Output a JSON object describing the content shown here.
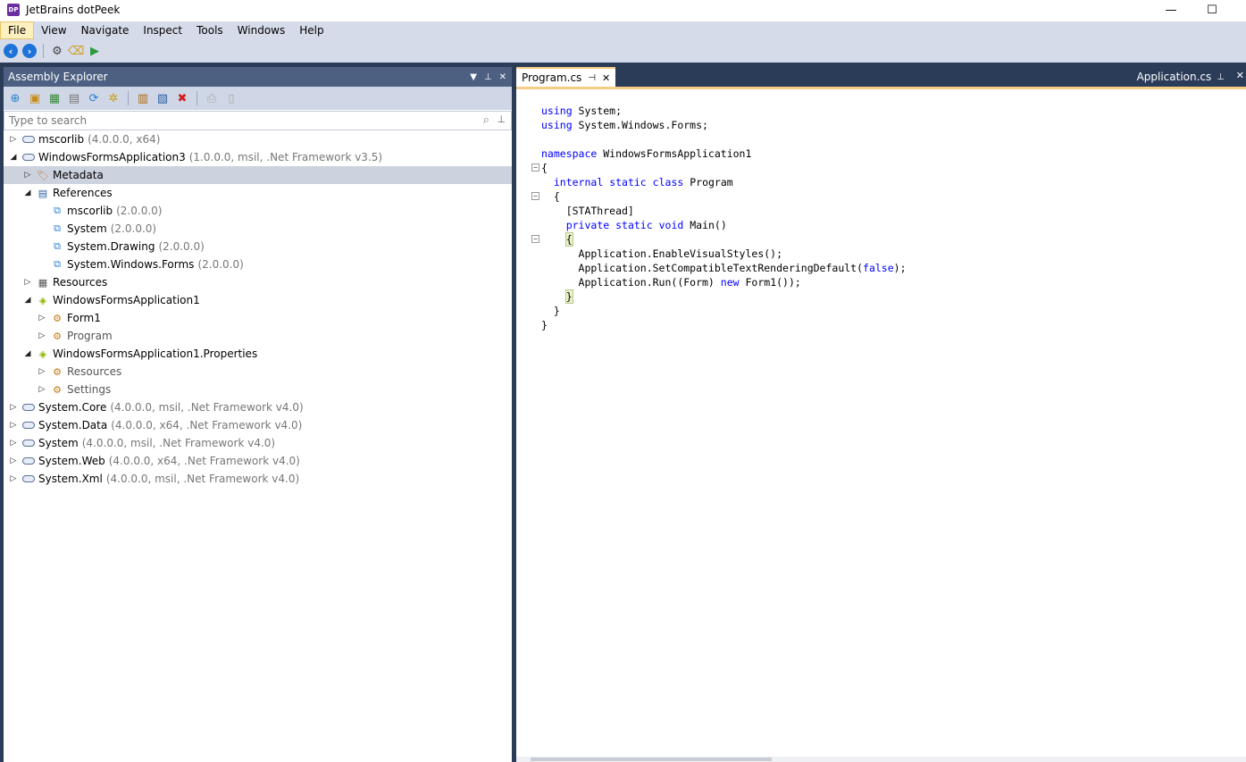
{
  "app": {
    "title": "JetBrains dotPeek",
    "icon_label": "DP"
  },
  "window_controls": {
    "minimize": "—",
    "maximize": "☐"
  },
  "menu": {
    "items": [
      "File",
      "View",
      "Navigate",
      "Inspect",
      "Tools",
      "Windows",
      "Help"
    ],
    "active": "File"
  },
  "toolbar": {
    "icons": [
      "back-icon",
      "forward-icon",
      "settings-icon",
      "find-usages-icon",
      "run-icon"
    ]
  },
  "assembly_explorer": {
    "title": "Assembly Explorer",
    "search_placeholder": "Type to search",
    "tree": [
      {
        "name": "mscorlib",
        "meta": "(4.0.0.0, x64)",
        "expander": "▷",
        "icon": "assembly-icon"
      },
      {
        "name": "WindowsFormsApplication3",
        "meta": "(1.0.0.0, msil, .Net Framework v3.5)",
        "expander": "◢",
        "icon": "assembly-icon"
      },
      {
        "name": "Metadata",
        "meta": "",
        "expander": "▷",
        "icon": "tag-icon",
        "selected": true
      },
      {
        "name": "References",
        "meta": "",
        "expander": "◢",
        "icon": "references-icon"
      },
      {
        "name": "mscorlib",
        "meta": "(2.0.0.0)",
        "expander": "",
        "icon": "reference-icon"
      },
      {
        "name": "System",
        "meta": "(2.0.0.0)",
        "expander": "",
        "icon": "reference-icon"
      },
      {
        "name": "System.Drawing",
        "meta": "(2.0.0.0)",
        "expander": "",
        "icon": "reference-icon"
      },
      {
        "name": "System.Windows.Forms",
        "meta": "(2.0.0.0)",
        "expander": "",
        "icon": "reference-icon"
      },
      {
        "name": "Resources",
        "meta": "",
        "expander": "▷",
        "icon": "resources-icon"
      },
      {
        "name": "WindowsFormsApplication1",
        "meta": "",
        "expander": "◢",
        "icon": "namespace-icon"
      },
      {
        "name": "Form1",
        "meta": "",
        "expander": "▷",
        "icon": "class-icon"
      },
      {
        "name": "Program",
        "meta": "",
        "expander": "▷",
        "icon": "class-icon",
        "dim": true
      },
      {
        "name": "WindowsFormsApplication1.Properties",
        "meta": "",
        "expander": "◢",
        "icon": "namespace-icon"
      },
      {
        "name": "Resources",
        "meta": "",
        "expander": "▷",
        "icon": "class-icon",
        "dim": true
      },
      {
        "name": "Settings",
        "meta": "",
        "expander": "▷",
        "icon": "class-icon",
        "dim": true
      },
      {
        "name": "System.Core",
        "meta": "(4.0.0.0, msil, .Net Framework v4.0)",
        "expander": "▷",
        "icon": "assembly-icon"
      },
      {
        "name": "System.Data",
        "meta": "(4.0.0.0, x64, .Net Framework v4.0)",
        "expander": "▷",
        "icon": "assembly-icon"
      },
      {
        "name": "System",
        "meta": "(4.0.0.0, msil, .Net Framework v4.0)",
        "expander": "▷",
        "icon": "assembly-icon"
      },
      {
        "name": "System.Web",
        "meta": "(4.0.0.0, x64, .Net Framework v4.0)",
        "expander": "▷",
        "icon": "assembly-icon"
      },
      {
        "name": "System.Xml",
        "meta": "(4.0.0.0, msil, .Net Framework v4.0)",
        "expander": "▷",
        "icon": "assembly-icon"
      }
    ]
  },
  "editor": {
    "active_tab": "Program.cs",
    "other_tab": "Application.cs",
    "code": [
      [
        {
          "t": "using",
          "k": true
        },
        {
          "t": " System;"
        }
      ],
      [
        {
          "t": "using",
          "k": true
        },
        {
          "t": " System.Windows.Forms;"
        }
      ],
      [],
      [
        {
          "t": "namespace",
          "k": true
        },
        {
          "t": " WindowsFormsApplication1"
        }
      ],
      [
        {
          "t": "{"
        }
      ],
      [
        {
          "t": "  "
        },
        {
          "t": "internal",
          "k": true
        },
        {
          "t": " "
        },
        {
          "t": "static",
          "k": true
        },
        {
          "t": " "
        },
        {
          "t": "class",
          "k": true
        },
        {
          "t": " Program"
        }
      ],
      [
        {
          "t": "  {"
        }
      ],
      [
        {
          "t": "    [STAThread]"
        }
      ],
      [
        {
          "t": "    "
        },
        {
          "t": "private",
          "k": true
        },
        {
          "t": " "
        },
        {
          "t": "static",
          "k": true
        },
        {
          "t": " "
        },
        {
          "t": "void",
          "k": true
        },
        {
          "t": " Main()"
        }
      ],
      [
        {
          "t": "    "
        },
        {
          "t": "{",
          "h": true
        }
      ],
      [
        {
          "t": "      Application.EnableVisualStyles();"
        }
      ],
      [
        {
          "t": "      Application.SetCompatibleTextRenderingDefault("
        },
        {
          "t": "false",
          "k": true
        },
        {
          "t": ");"
        }
      ],
      [
        {
          "t": "      Application.Run((Form) "
        },
        {
          "t": "new",
          "k": true
        },
        {
          "t": " Form1());"
        }
      ],
      [
        {
          "t": "    "
        },
        {
          "t": "}",
          "h": true
        }
      ],
      [
        {
          "t": "  }"
        }
      ],
      [
        {
          "t": "}"
        }
      ]
    ]
  }
}
